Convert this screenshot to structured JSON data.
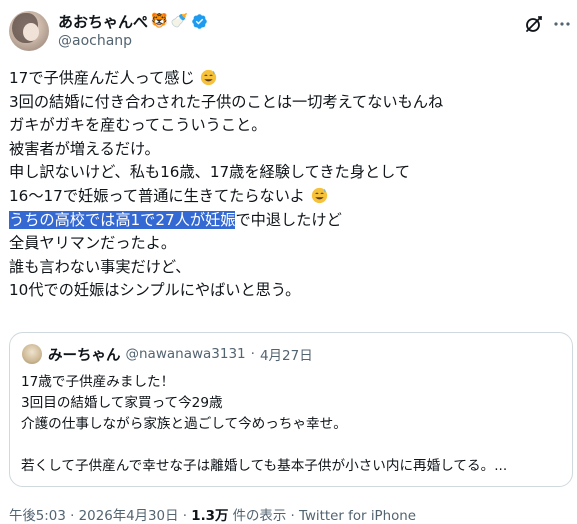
{
  "author": {
    "display_name": "あおちゃんぺ",
    "name_emoji_1": "🐯",
    "name_emoji_2": "🍼",
    "handle": "@aochanp"
  },
  "tweet": {
    "lines": [
      "17で子供産んだ人って感じ",
      "3回の結婚に付き合わされた子供のことは一切考えてないもんね",
      "ガキがガキを産むってこういうこと。",
      "被害者が増えるだけ。",
      "申し訳ないけど、私も16歳、17歳を経験してきた身として",
      "16〜17で妊娠って普通に生きてたらないよ",
      "",
      "全員ヤリマンだったよ。",
      "誰も言わない事実だけど、",
      "10代での妊娠はシンプルにやばいと思う。"
    ],
    "selected_text": "うちの高校では高1で27人が妊娠",
    "selected_line_rest": "で中退したけど"
  },
  "quoted": {
    "display_name": "みーちゃん",
    "handle": "@nawanawa3131",
    "separator": "·",
    "date": "4月27日",
    "lines": [
      "17歳で子供産みました！",
      "3回目の結婚して家買って今29歳",
      "介護の仕事しながら家族と過ごして今めっちゃ幸せ。",
      "",
      "若くして子供産んで幸せな子は離婚しても基本子供が小さい内に再婚してる。..."
    ]
  },
  "footer": {
    "time": "午後5:03",
    "sep1": "·",
    "date": "2026年4月30日",
    "sep2": "·",
    "views_count": "1.3万",
    "views_label": "件の表示",
    "sep3": "·",
    "client": "Twitter for iPhone"
  },
  "colors": {
    "selection": "#3468d2",
    "verified": "#1d9bf0",
    "secondary_text": "#536471"
  }
}
